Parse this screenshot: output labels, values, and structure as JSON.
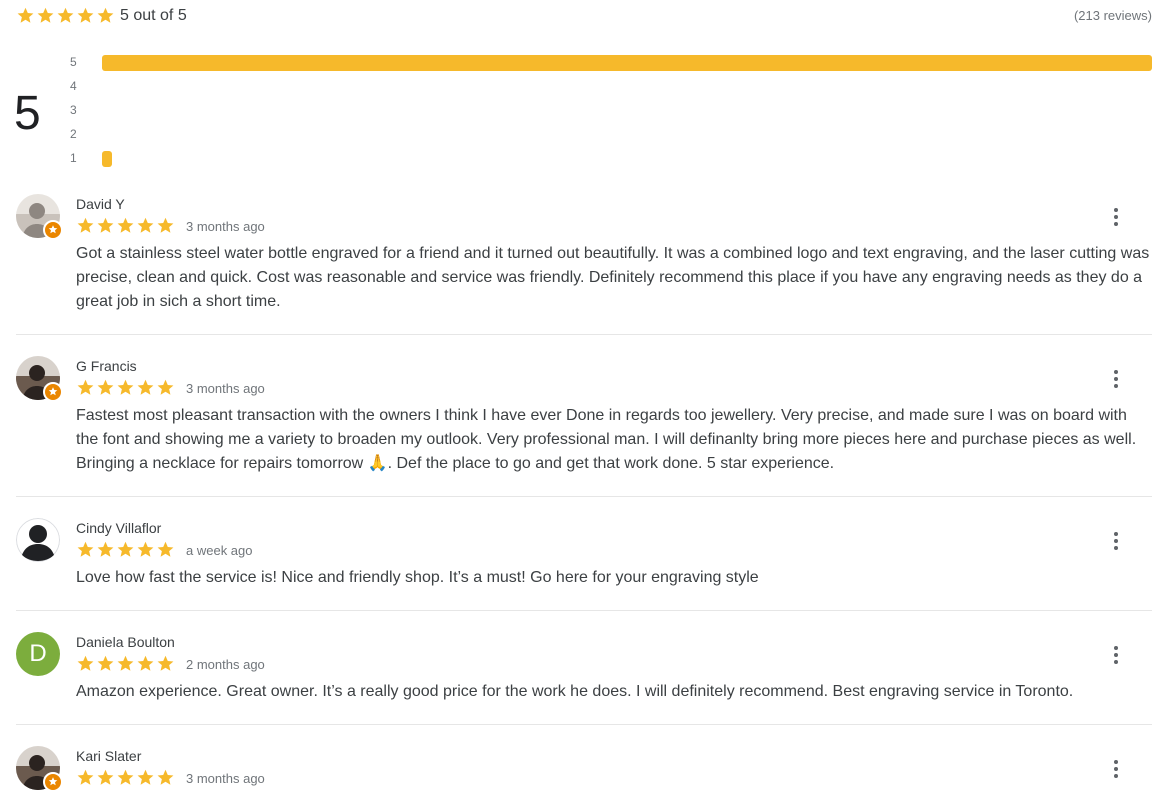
{
  "summary": {
    "rating_text": "5 out of 5",
    "review_count": "(213 reviews)",
    "rating_value": 5,
    "big_score": "5"
  },
  "histogram": [
    {
      "label": "5",
      "fraction": 1.0
    },
    {
      "label": "4",
      "fraction": 0.0
    },
    {
      "label": "3",
      "fraction": 0.0
    },
    {
      "label": "2",
      "fraction": 0.0
    },
    {
      "label": "1",
      "fraction": 0.009
    }
  ],
  "colors": {
    "star": "#f6b92b",
    "bar": "#f6b92b",
    "badge": "#ea8600",
    "avatar_green": "#7cad3d"
  },
  "reviews": [
    {
      "name": "David Y",
      "stars": 5,
      "date": "3 months ago",
      "text": "Got a stainless steel water bottle engraved for a friend and it turned out beautifully. It was a combined logo and text engraving, and the laser cutting was precise, clean and quick. Cost was reasonable and service was friendly. Definitely recommend this place if you have any engraving needs as they do a great job in sich a short time.",
      "avatar": "photo",
      "local_guide": true
    },
    {
      "name": "G Francis",
      "stars": 5,
      "date": "3 months ago",
      "text": "Fastest most pleasant transaction with the owners I think I have ever Done in regards too jewellery. Very precise, and made sure I was on board with the font and showing me a variety to broaden my outlook. Very professional man. I will definanlty bring more pieces here and purchase pieces as well. Bringing a necklace for repairs tomorrow 🙏. Def the place to go and get that work done. 5 star experience.",
      "avatar": "photo",
      "local_guide": true
    },
    {
      "name": "Cindy Villaflor",
      "stars": 5,
      "date": "a week ago",
      "text": "Love how fast the service is! Nice and friendly shop. It’s a must! Go here for your engraving style",
      "avatar": "silhouette",
      "local_guide": false
    },
    {
      "name": "Daniela Boulton",
      "stars": 5,
      "date": "2 months ago",
      "text": "Amazon experience. Great owner. It’s a really good price for the work he does. I will definitely recommend. Best engraving service in Toronto.",
      "avatar": "letter",
      "avatar_letter": "D",
      "local_guide": false
    },
    {
      "name": "Kari Slater",
      "stars": 5,
      "date": "3 months ago",
      "text": "",
      "avatar": "photo",
      "local_guide": true
    }
  ]
}
